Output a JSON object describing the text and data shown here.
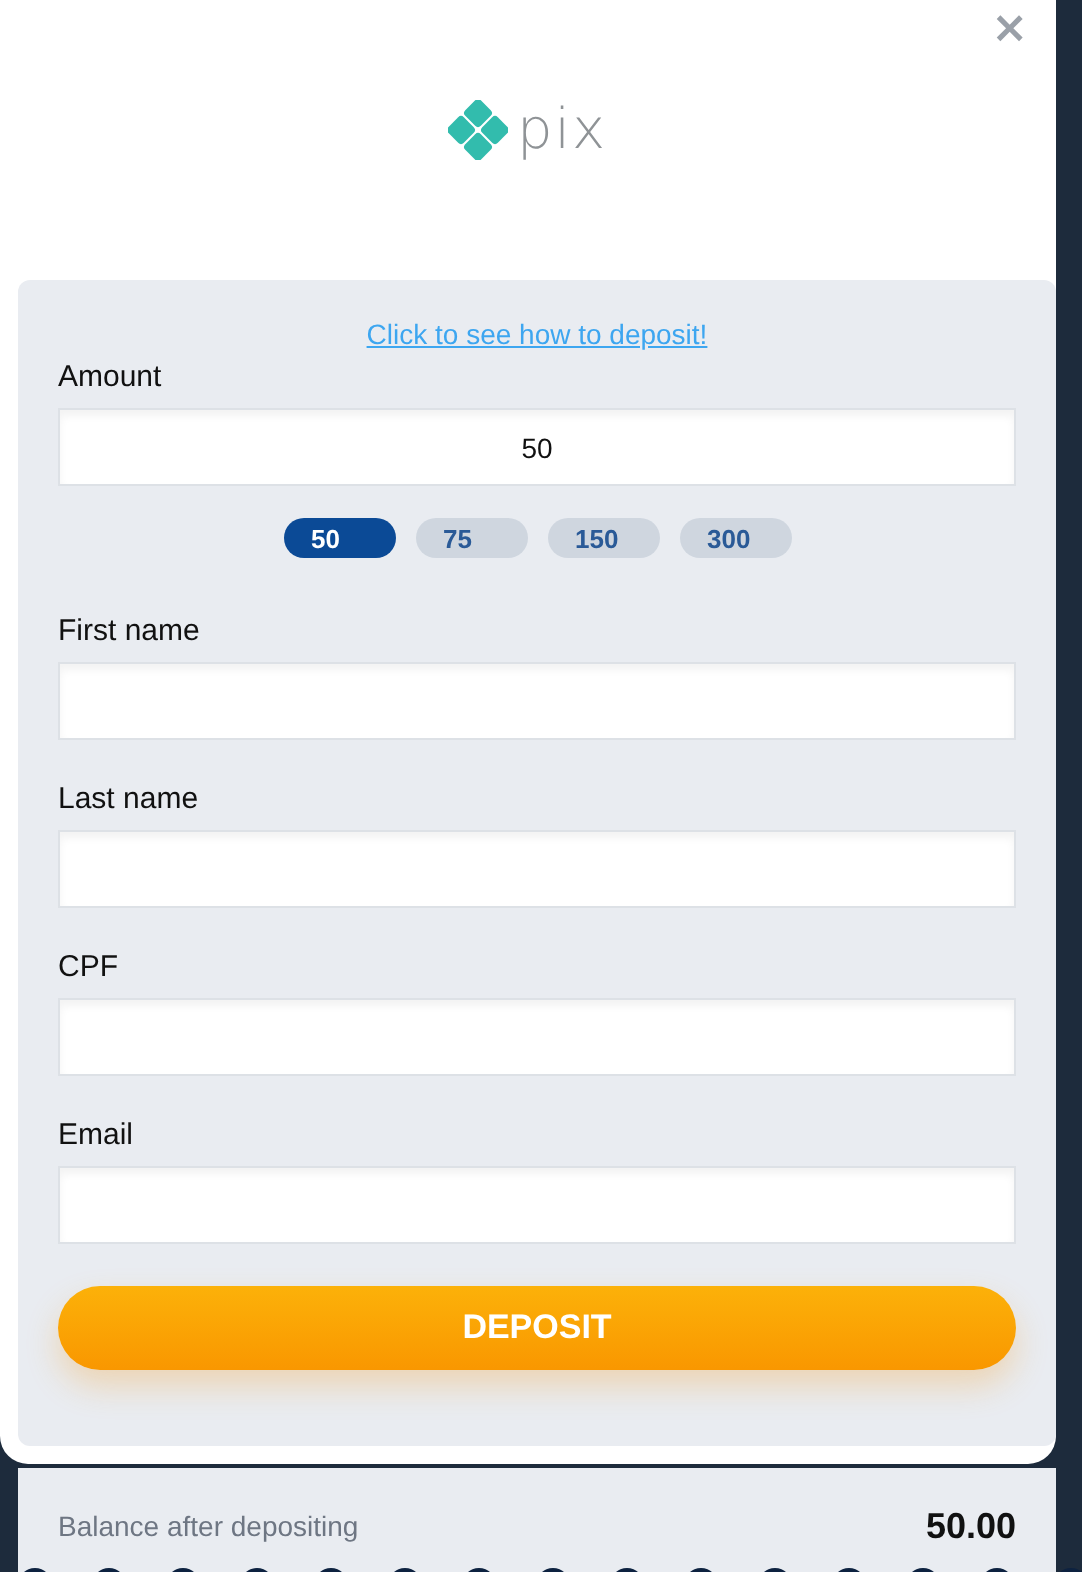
{
  "close": "×",
  "logo_text": "pix",
  "help_link": "Click to see how to deposit!",
  "amount": {
    "label": "Amount",
    "value": "50"
  },
  "presets": [
    {
      "label": "50",
      "selected": true
    },
    {
      "label": "75",
      "selected": false
    },
    {
      "label": "150",
      "selected": false
    },
    {
      "label": "300",
      "selected": false
    }
  ],
  "fields": [
    {
      "label": "First name"
    },
    {
      "label": "Last name"
    },
    {
      "label": "CPF"
    },
    {
      "label": "Email"
    }
  ],
  "submit": "DEPOSIT",
  "balance": {
    "label": "Balance after depositing",
    "value": "50.00"
  }
}
